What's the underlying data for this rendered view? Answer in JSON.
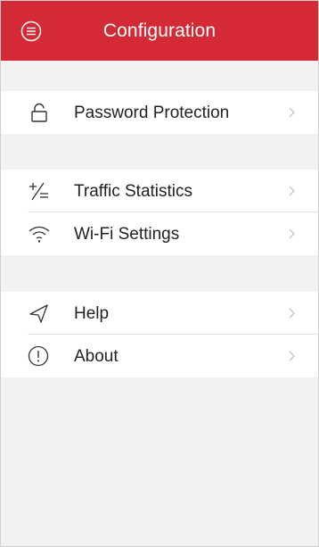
{
  "header": {
    "title": "Configuration",
    "menu_icon": "menu-lines-circle-icon",
    "background_color": "#d32a35"
  },
  "groups": [
    {
      "items": [
        {
          "label": "Password Protection",
          "icon": "lock-icon"
        }
      ]
    },
    {
      "items": [
        {
          "label": "Traffic Statistics",
          "icon": "plus-minus-icon"
        },
        {
          "label": "Wi-Fi Settings",
          "icon": "wifi-icon"
        }
      ]
    },
    {
      "items": [
        {
          "label": "Help",
          "icon": "send-arrow-icon"
        },
        {
          "label": "About",
          "icon": "info-circle-icon"
        }
      ]
    }
  ],
  "chevron_icon": "chevron-right-icon"
}
